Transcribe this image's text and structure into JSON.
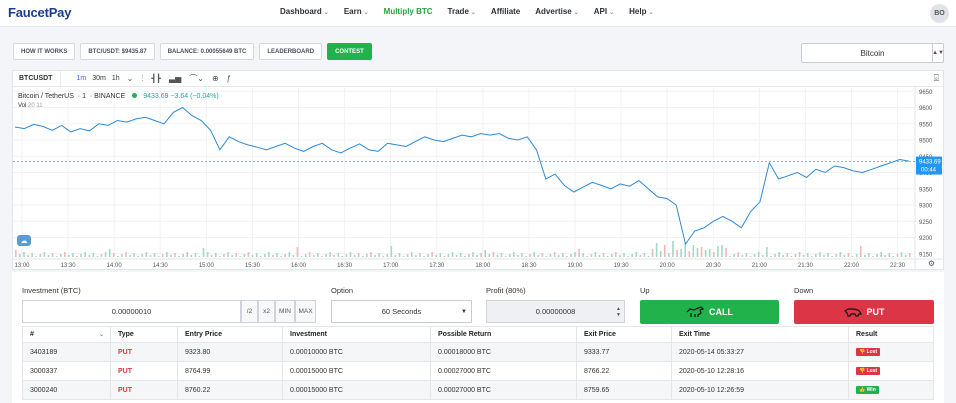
{
  "app": {
    "logo": "FaucetPay",
    "avatar": "BO"
  },
  "nav": {
    "items": [
      {
        "label": "Dashboard",
        "dropdown": true,
        "active": false
      },
      {
        "label": "Earn",
        "dropdown": true,
        "active": false
      },
      {
        "label": "Multiply BTC",
        "dropdown": false,
        "active": true
      },
      {
        "label": "Trade",
        "dropdown": true,
        "active": false
      },
      {
        "label": "Affiliate",
        "dropdown": false,
        "active": false
      },
      {
        "label": "Advertise",
        "dropdown": true,
        "active": false
      },
      {
        "label": "API",
        "dropdown": true,
        "active": false
      },
      {
        "label": "Help",
        "dropdown": true,
        "active": false
      }
    ]
  },
  "infobar": {
    "how_it_works": "HOW IT WORKS",
    "btc_usdt": "BTC/USDT: $9435.87",
    "balance": "BALANCE: 0.00055649 BTC",
    "leaderboard": "LEADERBOARD",
    "contest": "CONTEST"
  },
  "coin_select": {
    "value": "Bitcoin"
  },
  "chart": {
    "symbol": "BTCUSDT",
    "intervals": [
      "1m",
      "30m",
      "1h"
    ],
    "active_interval": "1m",
    "legend_name": "Bitcoin / TetherUS",
    "legend_interval": "1",
    "legend_exchange": "BINANCE",
    "legend_price": "9433.69",
    "legend_change": "−3.64 (−0.04%)",
    "volume_label": "Vol",
    "volume_value": "20",
    "volume_value2": "11",
    "current_price": "9433.69",
    "countdown": "00:44",
    "colors": {
      "line": "#2b8ad6",
      "last": "#2196f3",
      "vol_up": "#a3d9c3",
      "vol_down": "#f2b7b7"
    }
  },
  "chart_data": {
    "type": "line",
    "title": "",
    "xlabel": "",
    "ylabel": "",
    "x_ticks": [
      "13:00",
      "13:30",
      "14:00",
      "14:30",
      "15:00",
      "15:30",
      "16:00",
      "16:30",
      "17:00",
      "17:30",
      "18:00",
      "18:30",
      "19:00",
      "19:30",
      "20:00",
      "20:30",
      "21:00",
      "21:30",
      "22:00",
      "22:30"
    ],
    "y_ticks": [
      9150,
      9200,
      9250,
      9300,
      9350,
      9400,
      9450,
      9500,
      9550,
      9600,
      9650
    ],
    "ylim": [
      9140,
      9660
    ],
    "grid": true,
    "series": [
      {
        "values": [
          9540,
          9535,
          9548,
          9542,
          9530,
          9545,
          9525,
          9535,
          9528,
          9550,
          9545,
          9560,
          9555,
          9565,
          9570,
          9560,
          9550,
          9585,
          9600,
          9575,
          9560,
          9530,
          9470,
          9510,
          9495,
          9485,
          9478,
          9470,
          9480,
          9490,
          9475,
          9465,
          9480,
          9490,
          9470,
          9460,
          9475,
          9488,
          9470,
          9465,
          9490,
          9485,
          9480,
          9495,
          9510,
          9500,
          9495,
          9505,
          9515,
          9510,
          9520,
          9515,
          9520,
          9505,
          9500,
          9510,
          9470,
          9380,
          9395,
          9360,
          9340,
          9355,
          9370,
          9360,
          9350,
          9365,
          9358,
          9375,
          9350,
          9325,
          9320,
          9300,
          9180,
          9220,
          9230,
          9250,
          9265,
          9250,
          9230,
          9280,
          9310,
          9430,
          9380,
          9390,
          9400,
          9385,
          9410,
          9400,
          9420,
          9415,
          9405,
          9400,
          9410,
          9420,
          9430,
          9440,
          9435
        ]
      }
    ]
  },
  "trade": {
    "investment_label": "Investment (BTC)",
    "investment_value": "0.00000010",
    "div2": "/2",
    "x2": "x2",
    "min": "MIN",
    "max": "MAX",
    "option_label": "Option",
    "option_value": "60 Seconds",
    "profit_label": "Profit (80%)",
    "profit_value": "0.00000008",
    "up_label": "Up",
    "down_label": "Down",
    "call_label": "CALL",
    "put_label": "PUT"
  },
  "table": {
    "headers": [
      "#",
      "Type",
      "Entry Price",
      "Investment",
      "Possible Return",
      "Exit Price",
      "Exit Time",
      "Result"
    ],
    "rows": [
      {
        "id": "3403189",
        "type": "PUT",
        "entry": "9323.80",
        "investment": "0.00010000 BTC",
        "return": "0.00018000 BTC",
        "exit": "9333.77",
        "time": "2020-05-14 05:33:27",
        "result": "Lost"
      },
      {
        "id": "3000337",
        "type": "PUT",
        "entry": "8764.99",
        "investment": "0.00015000 BTC",
        "return": "0.00027000 BTC",
        "exit": "8766.22",
        "time": "2020-05-10 12:28:16",
        "result": "Lost"
      },
      {
        "id": "3000240",
        "type": "PUT",
        "entry": "8760.22",
        "investment": "0.00015000 BTC",
        "return": "0.00027000 BTC",
        "exit": "8759.65",
        "time": "2020-05-10 12:26:59",
        "result": "Win"
      }
    ]
  }
}
